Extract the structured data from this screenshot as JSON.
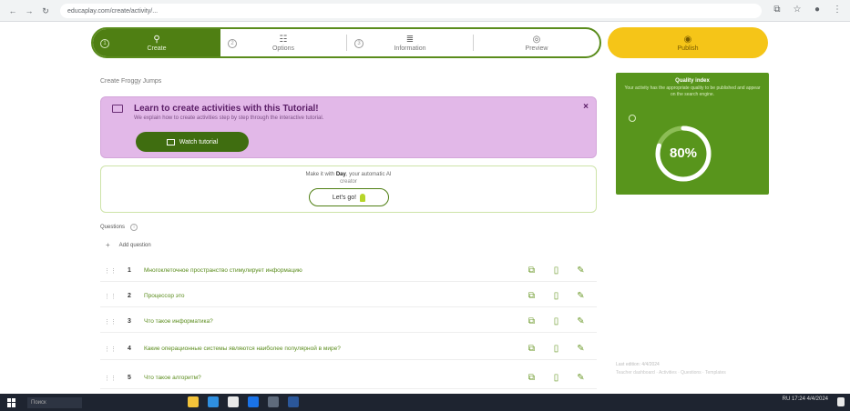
{
  "browser": {
    "url": "educaplay.com/create/activity/...",
    "icons": [
      "back-icon",
      "forward-icon",
      "reload-icon",
      "lock-icon",
      "extensions-icon",
      "star-icon",
      "profile-icon",
      "menu-icon"
    ]
  },
  "steps": [
    {
      "label": "Create",
      "icon": "search-icon",
      "active": true
    },
    {
      "label": "Options",
      "icon": "sliders-icon",
      "active": false
    },
    {
      "label": "Information",
      "icon": "list-icon",
      "active": false
    },
    {
      "label": "Preview",
      "icon": "eye-icon",
      "active": false
    }
  ],
  "publish": {
    "label": "Publish",
    "icon": "eye-icon"
  },
  "breadcrumb": "Create Froggy Jumps",
  "tutorial": {
    "title": "Learn to create activities with this Tutorial!",
    "subtitle": "We explain how to create activities step by step through the interactive tutorial.",
    "button_label": "Watch tutorial",
    "close": "×"
  },
  "assistant": {
    "text_pre": "Make it with ",
    "name": "Day",
    "text_post": ", your automatic AI",
    "sub": "creator",
    "button_label": "Let's go!"
  },
  "questions": {
    "header": "Questions",
    "info": "i",
    "add_label": "Add question",
    "items": [
      {
        "num": "1",
        "text": "Многоклеточное пространство стимулирует информацию"
      },
      {
        "num": "2",
        "text": "Процессор это"
      },
      {
        "num": "3",
        "text": "Что такое информатика?"
      },
      {
        "num": "4",
        "text": "Какие операционные системы являются наиболее популярной в мире?"
      },
      {
        "num": "5",
        "text": "Что такое алгоритм?"
      }
    ]
  },
  "quality": {
    "title": "Quality index",
    "description": "Your activity has the appropriate quality to be published and appear on the search engine.",
    "percent": "80%",
    "fraction": 0.8
  },
  "footnote": {
    "line1": "Last edition: 4/4/2024",
    "line2": "Teacher dashboard · Activities · Questions · Templates"
  },
  "taskbar": {
    "search_placeholder": "Поиск",
    "clock": "RU 17:24 4/4/2024",
    "apps": [
      "file-explorer-icon",
      "edge-icon",
      "chrome-icon",
      "mail-icon",
      "store-icon",
      "word-icon"
    ]
  },
  "colors": {
    "primary_green": "#4f7f13",
    "publish_yellow": "#f5c518",
    "tutorial_purple": "#e2b8e8",
    "quality_green": "#58951c"
  }
}
